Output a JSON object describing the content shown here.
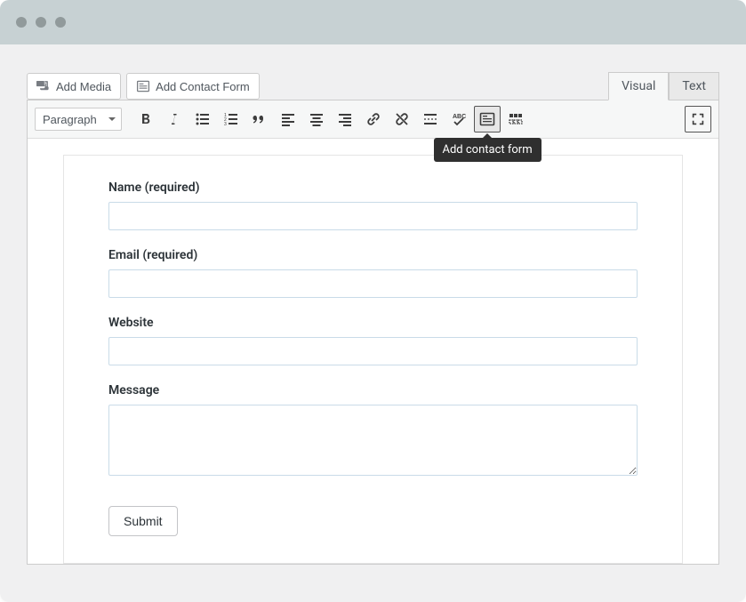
{
  "buttons": {
    "add_media": "Add Media",
    "add_contact_form": "Add Contact Form"
  },
  "tabs": {
    "visual": "Visual",
    "text": "Text"
  },
  "toolbar": {
    "format": "Paragraph",
    "tooltip": "Add contact form"
  },
  "form": {
    "name_label": "Name (required)",
    "email_label": "Email (required)",
    "website_label": "Website",
    "message_label": "Message",
    "submit": "Submit"
  }
}
